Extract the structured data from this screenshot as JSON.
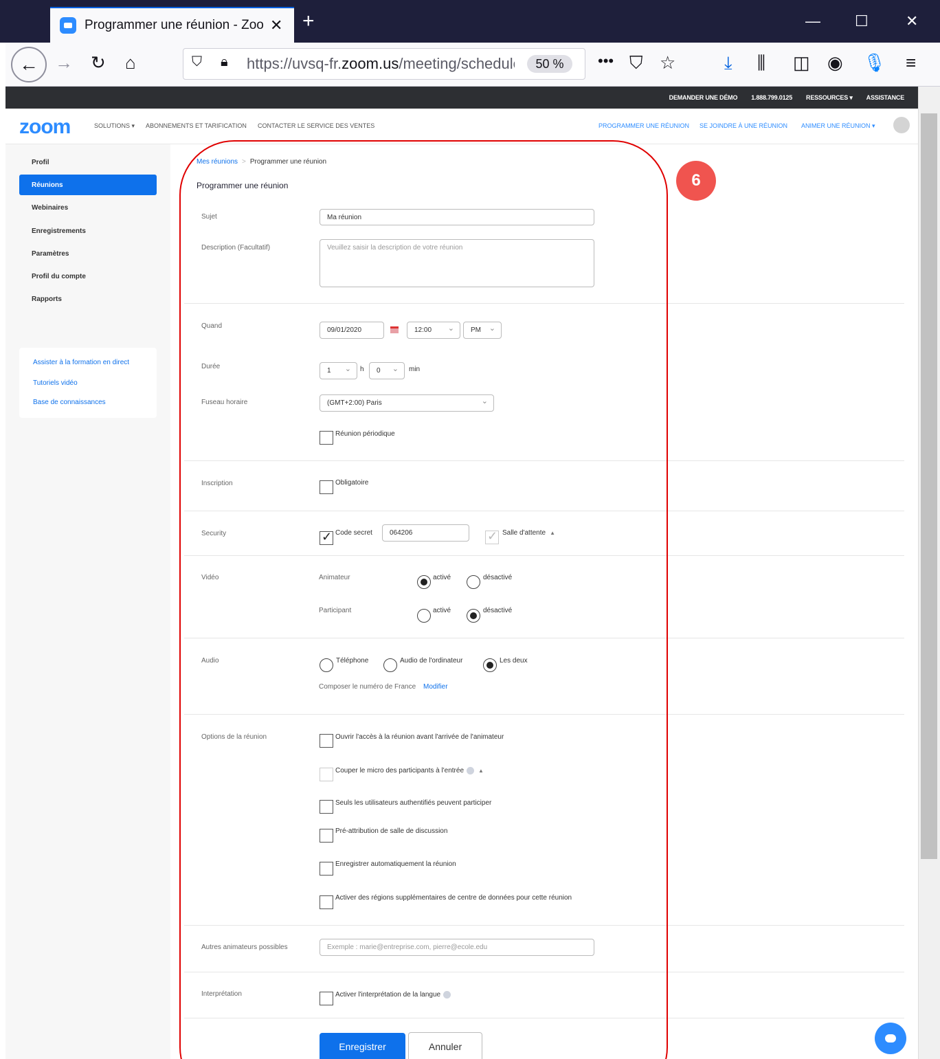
{
  "browser": {
    "tab_title": "Programmer une réunion - Zoom",
    "new_tab": "+",
    "url_host_prefix": "https://uvsq-fr.",
    "url_domain": "zoom.us",
    "url_path": "/meeting/schedule",
    "zoom_level": "50 %"
  },
  "topstrip": {
    "demo": "DEMANDER UNE DÉMO",
    "phone": "1.888.799.0125",
    "resources": "RESSOURCES ▾",
    "support": "ASSISTANCE"
  },
  "nav": {
    "logo": "zoom",
    "solutions": "SOLUTIONS ▾",
    "plans": "ABONNEMENTS ET TARIFICATION",
    "sales": "CONTACTER LE SERVICE DES VENTES",
    "schedule": "PROGRAMMER UNE RÉUNION",
    "join": "SE JOINDRE À UNE RÉUNION",
    "host": "ANIMER UNE RÉUNION ▾"
  },
  "sidebar": {
    "items": [
      "Profil",
      "Réunions",
      "Webinaires",
      "Enregistrements",
      "Paramètres",
      "Profil du compte",
      "Rapports"
    ],
    "help_links": [
      "Assister à la formation en direct",
      "Tutoriels vidéo",
      "Base de connaissances"
    ]
  },
  "breadcrumb": {
    "parent": "Mes réunions",
    "sep": ">",
    "current": "Programmer une réunion"
  },
  "page_title": "Programmer une réunion",
  "form": {
    "topic_label": "Sujet",
    "topic_value": "Ma réunion",
    "desc_label": "Description (Facultatif)",
    "desc_placeholder": "Veuillez saisir la description de votre réunion",
    "when_label": "Quand",
    "date": "09/01/2020",
    "time": "12:00",
    "ampm": "PM",
    "duration_label": "Durée",
    "hours": "1",
    "h_unit": "h",
    "minutes": "0",
    "min_unit": "min",
    "tz_label": "Fuseau horaire",
    "tz_value": "(GMT+2:00) Paris",
    "recurring": "Réunion périodique",
    "registration_label": "Inscription",
    "required": "Obligatoire",
    "security_label": "Security",
    "passcode_label": "Code secret",
    "passcode_value": "064206",
    "waiting_room": "Salle d'attente",
    "video_label": "Vidéo",
    "host_label": "Animateur",
    "participant_label": "Participant",
    "on": "activé",
    "off": "désactivé",
    "audio_label": "Audio",
    "audio_phone": "Téléphone",
    "audio_computer": "Audio de l'ordinateur",
    "audio_both": "Les deux",
    "dial_from": "Composer le numéro de France",
    "modify": "Modifier",
    "options_label": "Options de la réunion",
    "opt_join_before": "Ouvrir l'accès à la réunion avant l'arrivée de l'animateur",
    "opt_mute": "Couper le micro des participants à l'entrée",
    "opt_auth": "Seuls les utilisateurs authentifiés peuvent participer",
    "opt_breakout": "Pré-attribution de salle de discussion",
    "opt_record": "Enregistrer automatiquement la réunion",
    "opt_regions": "Activer des régions supplémentaires de centre de données pour cette réunion",
    "alt_hosts_label": "Autres animateurs possibles",
    "alt_hosts_placeholder": "Exemple : marie@entreprise.com, pierre@ecole.edu",
    "interp_label": "Interprétation",
    "interp_option": "Activer l'interprétation de la langue",
    "save": "Enregistrer",
    "cancel": "Annuler"
  },
  "annotation": {
    "step": "6",
    "color": "#e00000"
  },
  "colors": {
    "accent": "#0e71eb",
    "brand": "#2d8cff"
  }
}
